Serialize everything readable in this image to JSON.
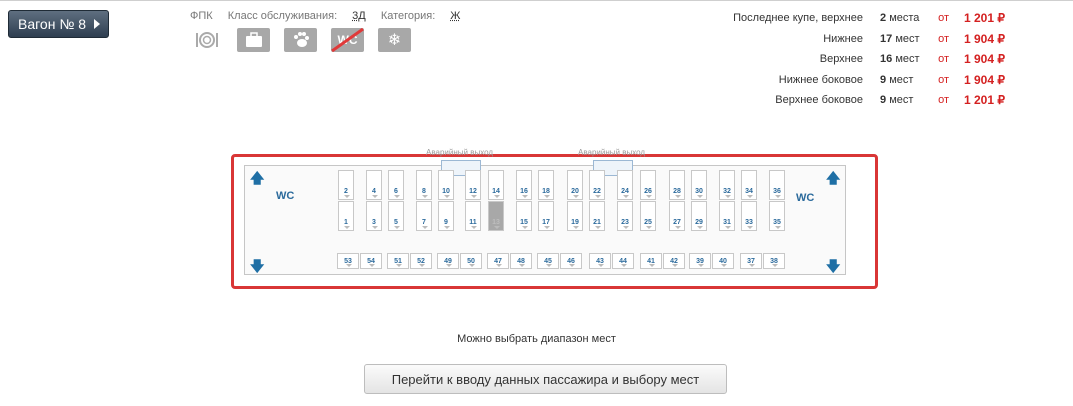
{
  "wagon": {
    "label": "Вагон  № 8"
  },
  "meta": {
    "carrier": "ФПК",
    "class_label": "Класс обслуживания:",
    "class_value": "3Д",
    "category_label": "Категория:",
    "category_value": "Ж"
  },
  "services": [
    "meal-icon",
    "luggage-icon",
    "pet-icon",
    "no-wc-icon",
    "air-conditioning-icon"
  ],
  "prices": [
    {
      "type": "Последнее купе, верхнее",
      "count": "2",
      "unit": "места",
      "from": "от",
      "price": "1 201 ₽"
    },
    {
      "type": "Нижнее",
      "count": "17",
      "unit": "мест",
      "from": "от",
      "price": "1 904 ₽"
    },
    {
      "type": "Верхнее",
      "count": "16",
      "unit": "мест",
      "from": "от",
      "price": "1 904 ₽"
    },
    {
      "type": "Нижнее боковое",
      "count": "9",
      "unit": "мест",
      "from": "от",
      "price": "1 904 ₽"
    },
    {
      "type": "Верхнее боковое",
      "count": "9",
      "unit": "мест",
      "from": "от",
      "price": "1 201 ₽"
    }
  ],
  "scheme": {
    "emergency_exit": "Аварийный выход",
    "wc": "WC",
    "upper_seats": [
      "2",
      "4",
      "6",
      "8",
      "10",
      "12",
      "14",
      "16",
      "18",
      "20",
      "22",
      "24",
      "26",
      "28",
      "30",
      "32",
      "34",
      "36"
    ],
    "lower_seats": [
      "1",
      "3",
      "5",
      "7",
      "9",
      "11",
      "13",
      "15",
      "17",
      "19",
      "21",
      "23",
      "25",
      "27",
      "29",
      "31",
      "33",
      "35"
    ],
    "busy_seats": [
      "13"
    ],
    "side_seats": [
      "53",
      "54",
      "51",
      "52",
      "49",
      "50",
      "47",
      "48",
      "45",
      "46",
      "43",
      "44",
      "41",
      "42",
      "39",
      "40",
      "37",
      "38"
    ]
  },
  "hint": "Можно выбрать диапазон мест",
  "go_button": "Перейти к вводу данных пассажира и выбору мест"
}
